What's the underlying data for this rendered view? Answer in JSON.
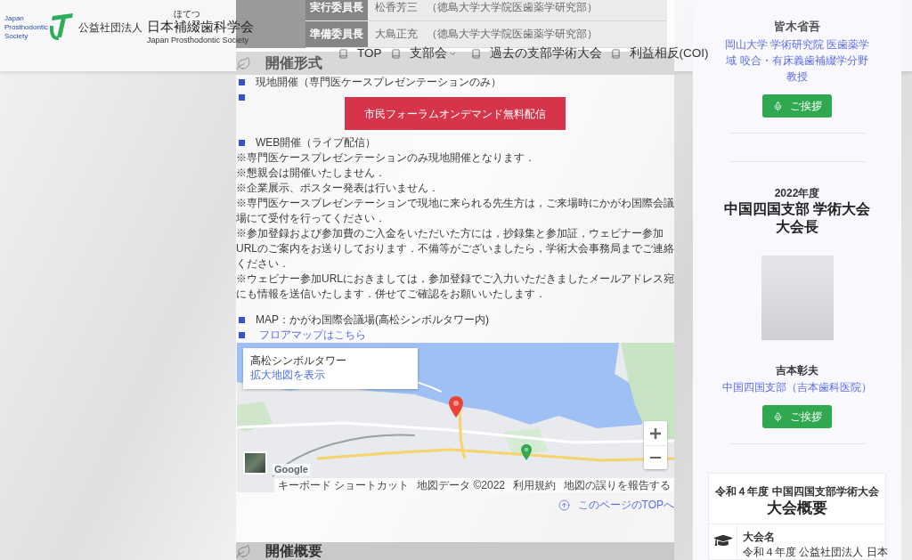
{
  "header": {
    "logo_text": [
      "Japan",
      "Prosthodontic",
      "Society"
    ],
    "org_type": "公益社団法人",
    "name_ruby": "ほてつ",
    "name": "日本補綴歯科学会",
    "english_name": "Japan Prosthodontic Society"
  },
  "nav": [
    {
      "label": "TOP",
      "dropdown": false
    },
    {
      "label": "支部会",
      "dropdown": true
    },
    {
      "label": "過去の支部学術大会",
      "dropdown": false
    },
    {
      "label": "利益相反(COI)",
      "dropdown": false
    }
  ],
  "committee": [
    {
      "role": "実行委員長",
      "name": "松香芳三",
      "affiliation": "（徳島大学大学院医歯薬学研究部）"
    },
    {
      "role": "準備委員長",
      "name": "大島正充",
      "affiliation": "（徳島大学大学院医歯薬学研究部）"
    }
  ],
  "format_section": {
    "heading": "開催形式",
    "items": [
      {
        "kind": "text",
        "text": "現地開催（専門医ケースプレゼンテーションのみ）"
      },
      {
        "kind": "button",
        "text": "市民フォーラムオンデマンド無料配信"
      },
      {
        "kind": "text",
        "text": "WEB開催（ライブ配信）"
      }
    ],
    "notes": [
      "※専門医ケースプレゼンテーションのみ現地開催となります．",
      "※懇親会は開催いたしません．",
      "※企業展示、ポスター発表は行いません．",
      "※専門医ケースプレゼンテーションで現地に来られる先生方は，ご来場時にかがわ国際会議場にて受付を行ってください．",
      "※参加登録および参加費のご入金をいただいた方には，抄録集と参加証，ウェビナー参加URLのご案内をお送りしております．不備等がございましたら，学術大会事務局までご連絡ください．",
      "※ウェビナー参加URLにおきましては，参加登録でご入力いただきましたメールアドレス宛にも情報を送信いたします．併せてご確認をお願いいたします．"
    ],
    "venue_items": [
      {
        "kind": "text",
        "text": "MAP：かがわ国際会議場(高松シンボルタワー内)"
      },
      {
        "kind": "link",
        "text": "フロアマップはこちら"
      }
    ]
  },
  "map": {
    "place_name": "高松シンボルタワー",
    "larger_map_link": "拡大地図を表示",
    "logo": "Google",
    "footer_links": [
      "キーボード ショートカット",
      "地図データ ©2022",
      "利用規約",
      "地図の誤りを報告する"
    ]
  },
  "page_top_link": "このページのTOPへ",
  "next_section": {
    "heading": "開催概要"
  },
  "sidebar": {
    "previous_person": {
      "name": "皆木省吾",
      "affiliation": "岡山大学 学術研究院 医歯薬学域 咬合・有床義歯補綴学分野",
      "title": "教授",
      "button": "ご挨拶"
    },
    "president": {
      "year": "2022年度",
      "heading_lines": [
        "中国四国支部 学術大会",
        "大会長"
      ],
      "name": "吉本彰夫",
      "affiliation": "中国四国支部（吉本歯科医院）",
      "button": "ご挨拶"
    },
    "overview": {
      "subtitle": "令和４年度 中国四国支部学術大会",
      "title": "大会概要",
      "rows": [
        {
          "label": "大会名",
          "value": "令和４年度 公益社団法人 日本"
        }
      ]
    }
  }
}
